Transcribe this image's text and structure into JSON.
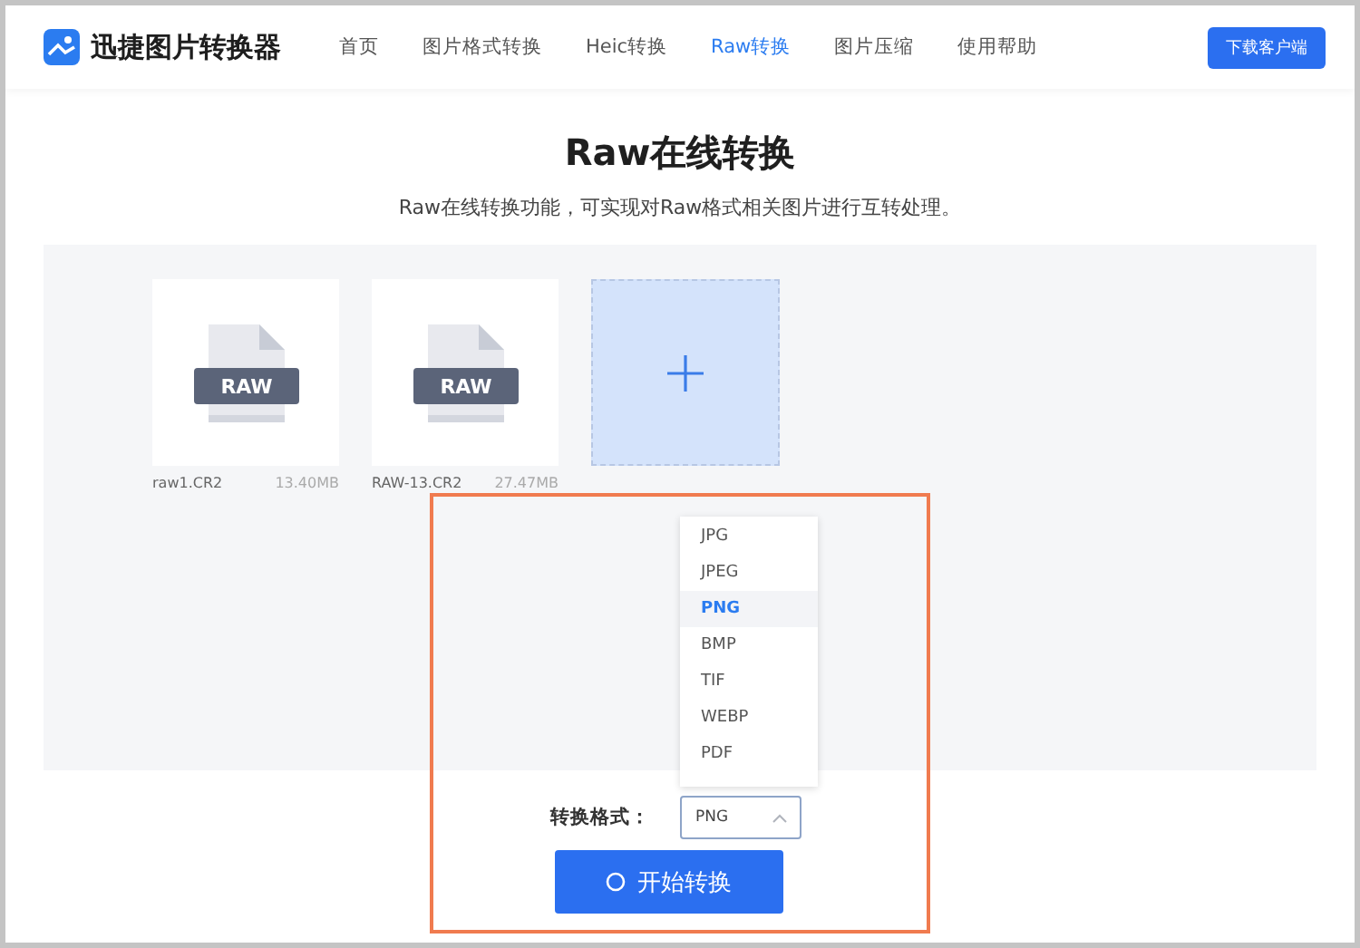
{
  "header": {
    "brand": "迅捷图片转换器",
    "nav": [
      {
        "label": "首页",
        "selected": false
      },
      {
        "label": "图片格式转换",
        "selected": false
      },
      {
        "label": "Heic转换",
        "selected": false
      },
      {
        "label": "Raw转换",
        "selected": true
      },
      {
        "label": "图片压缩",
        "selected": false
      },
      {
        "label": "使用帮助",
        "selected": false
      }
    ],
    "download_button": "下载客户端"
  },
  "title": "Raw在线转换",
  "subtitle": "Raw在线转换功能，可实现对Raw格式相关图片进行互转处理。",
  "files": [
    {
      "badge": "RAW",
      "name": "raw1.CR2",
      "size": "13.40MB"
    },
    {
      "badge": "RAW",
      "name": "RAW-13.CR2",
      "size": "27.47MB"
    }
  ],
  "format": {
    "label": "转换格式：",
    "value": "PNG",
    "expanded": true,
    "options": [
      {
        "label": "JPG",
        "selected": false
      },
      {
        "label": "JPEG",
        "selected": false
      },
      {
        "label": "PNG",
        "selected": true
      },
      {
        "label": "BMP",
        "selected": false
      },
      {
        "label": "TIF",
        "selected": false
      },
      {
        "label": "WEBP",
        "selected": false
      },
      {
        "label": "PDF",
        "selected": false
      }
    ]
  },
  "start_button": "开始转换"
}
